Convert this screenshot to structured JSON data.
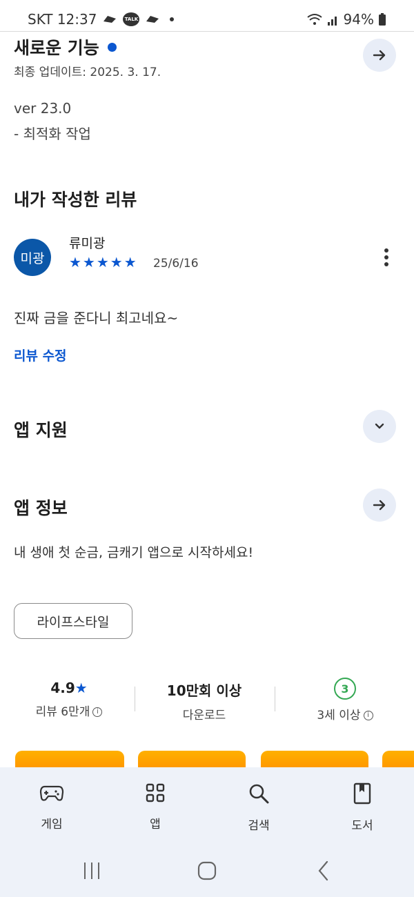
{
  "status_bar": {
    "carrier_time": "SKT 12:37",
    "talk_label": "TALK",
    "battery": "94%"
  },
  "whats_new": {
    "title": "새로운 기능",
    "updated": "최종 업데이트: 2025. 3. 17.",
    "version": "ver 23.0",
    "note": "- 최적화 작업"
  },
  "my_review": {
    "title": "내가 작성한 리뷰",
    "avatar_text": "미광",
    "reviewer": "류미광",
    "stars": "★★★★★",
    "rating_value": 5,
    "date": "25/6/16",
    "text": "진짜 금을 준다니 최고네요~",
    "edit_link": "리뷰 수정"
  },
  "app_support": {
    "title": "앱 지원"
  },
  "app_info": {
    "title": "앱 정보",
    "description": "내 생애 첫 순금, 금캐기 앱으로 시작하세요!",
    "category_chip": "라이프스타일"
  },
  "stats": {
    "rating": "4.9",
    "rating_star": "★",
    "reviews": "리뷰 6만개",
    "downloads": "10만회 이상",
    "downloads_label": "다운로드",
    "age_badge": "3",
    "age_label": "3세 이상"
  },
  "bottom_nav": {
    "games": "게임",
    "apps": "앱",
    "search": "검색",
    "books": "도서"
  },
  "colors": {
    "accent": "#0b57d0",
    "age_green": "#34a853",
    "banner": "#ff9a00"
  }
}
